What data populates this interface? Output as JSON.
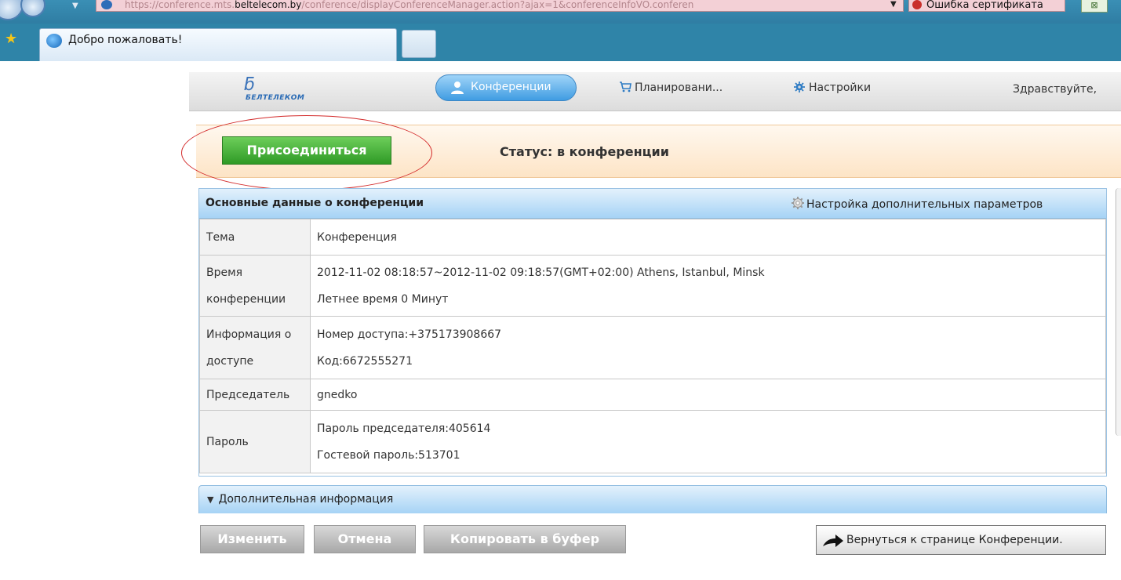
{
  "browser": {
    "address_prefix": "https://conference.mts.",
    "address_domain": "beltelecom.by",
    "address_suffix": "/conference/displayConferenceManager.action?ajax=1&conferenceInfoVO.conferen",
    "cert_error": "Ошибка сертификата",
    "tab_title": "Добро пожаловать!"
  },
  "header": {
    "logo_text": "БЕЛТЕЛЕКОМ",
    "nav_conferences": "Конференции",
    "nav_planning": "Планировани...",
    "nav_settings": "Настройки",
    "greeting": "Здравствуйте,"
  },
  "status": {
    "join_label": "Присоединиться",
    "status_text": "Статус: в конференции"
  },
  "panel": {
    "title": "Основные данные о конференции",
    "extra_settings": "Настройка дополнительных параметров",
    "rows": [
      {
        "label": "Тема",
        "lines": [
          "Конференция"
        ]
      },
      {
        "label": "Время конференции",
        "lines": [
          "2012-11-02 08:18:57~2012-11-02 09:18:57(GMT+02:00) Athens, Istanbul, Minsk",
          "Летнее время 0 Минут"
        ]
      },
      {
        "label": "Информация о доступе",
        "lines": [
          "Номер доступа:+375173908667",
          "Код:6672555271"
        ]
      },
      {
        "label": "Председатель",
        "lines": [
          "gnedko"
        ]
      },
      {
        "label": "Пароль",
        "lines": [
          "Пароль председателя:405614",
          "Гостевой пароль:513701"
        ]
      }
    ]
  },
  "more": {
    "label": "Дополнительная информация"
  },
  "actions": {
    "edit": "Изменить",
    "cancel": "Отмена",
    "copy": "Копировать в буфер",
    "back": "Вернуться к странице Конференции."
  }
}
